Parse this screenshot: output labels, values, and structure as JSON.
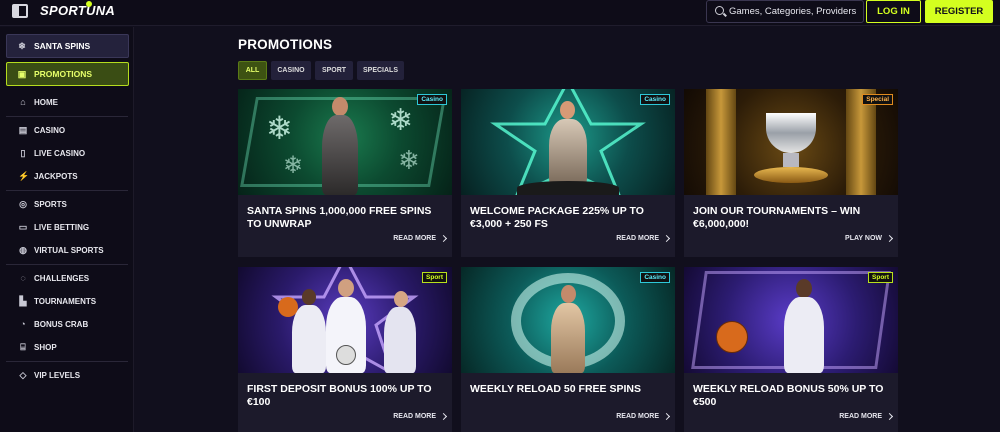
{
  "header": {
    "logo": "SPORTUNA",
    "search_placeholder": "Games, Categories, Providers",
    "login_label": "LOG IN",
    "register_label": "REGISTER"
  },
  "sidebar": {
    "santa_spins": "SANTA SPINS",
    "promotions": "PROMOTIONS",
    "home": "HOME",
    "casino": "CASINO",
    "live_casino": "LIVE CASINO",
    "jackpots": "JACKPOTS",
    "sports": "SPORTS",
    "live_betting": "LIVE BETTING",
    "virtual_sports": "VIRTUAL SPORTS",
    "challenges": "CHALLENGES",
    "tournaments": "TOURNAMENTS",
    "bonus_crab": "BONUS CRAB",
    "shop": "SHOP",
    "vip_levels": "VIP LEVELS"
  },
  "main": {
    "title": "PROMOTIONS",
    "filters": [
      "ALL",
      "CASINO",
      "SPORT",
      "SPECIALS"
    ],
    "cards": [
      {
        "badge": "Casino",
        "title": "SANTA SPINS 1,000,000 FREE SPINS TO UNWRAP",
        "cta": "READ MORE"
      },
      {
        "badge": "Casino",
        "title": "WELCOME PACKAGE 225% UP TO €3,000 + 250 FS",
        "cta": "READ MORE"
      },
      {
        "badge": "Special",
        "title": "JOIN OUR TOURNAMENTS – WIN €6,000,000!",
        "cta": "PLAY NOW"
      },
      {
        "badge": "Sport",
        "title": "FIRST DEPOSIT BONUS 100% UP TO €100",
        "cta": "READ MORE"
      },
      {
        "badge": "Casino",
        "title": "WEEKLY RELOAD 50 FREE SPINS",
        "cta": "READ MORE"
      },
      {
        "badge": "Sport",
        "title": "WEEKLY RELOAD BONUS 50% UP TO €500",
        "cta": "READ MORE"
      }
    ]
  },
  "colors": {
    "accent": "#d4ff1f",
    "background": "#110f1d",
    "card": "#1c1a2b",
    "badge_casino": "#2ec8d8",
    "badge_special": "#e08b1f",
    "badge_sport": "#b8e01c"
  }
}
